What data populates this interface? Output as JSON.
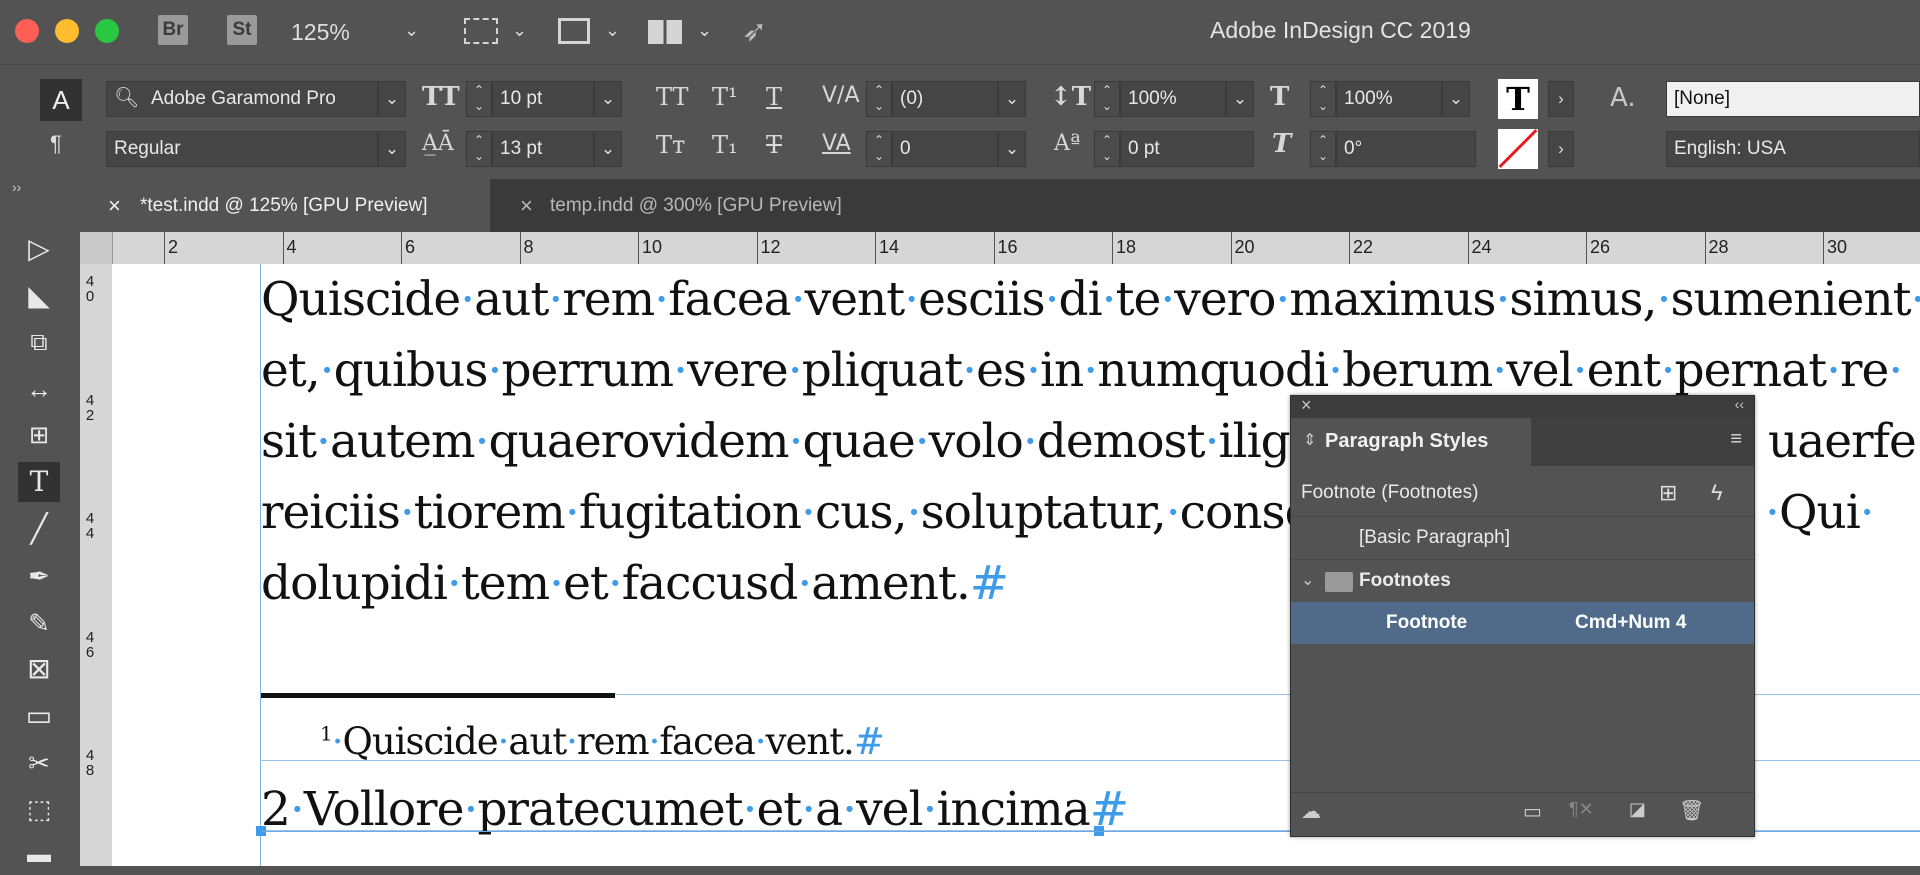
{
  "app": {
    "title": "Adobe InDesign CC 2019",
    "zoom": "125%",
    "bridge_label": "Br",
    "stock_label": "St"
  },
  "control_panel": {
    "font_family": "Adobe Garamond Pro",
    "font_style": "Regular",
    "font_size": "10 pt",
    "leading": "13 pt",
    "kerning": "(0)",
    "tracking": "0",
    "vertical_scale": "100%",
    "horizontal_scale": "100%",
    "baseline_shift": "0 pt",
    "skew": "0°",
    "char_style": "[None]",
    "language": "English: USA"
  },
  "tabs": [
    {
      "label": "*test.indd @ 125% [GPU Preview]",
      "active": true
    },
    {
      "label": "temp.indd @ 300% [GPU Preview]",
      "active": false
    }
  ],
  "ruler": {
    "h_ticks": [
      "2",
      "4",
      "6",
      "8",
      "10",
      "12",
      "14",
      "16",
      "18",
      "20",
      "22",
      "24",
      "26",
      "28",
      "30"
    ],
    "v_ticks": [
      "40",
      "42",
      "44",
      "46",
      "48"
    ]
  },
  "document": {
    "body_lines": [
      "Quiscide·aut·rem·facea·vent·esciis·di·te·vero·maximus·simus,·sumenient·",
      "et,·quibus·perrum·vere·pliquat·es·in·numquodi·berum·vel·ent·pernat·re·",
      "sit·autem·quaerovidem·quae·volo·demost·ilign",
      "reiciis·tiorem·fugitation·cus,·soluptatur,·conse",
      "dolupidi·tem·et·faccusd·ament."
    ],
    "line3_tail": "uaerfe·",
    "line4_tail": "·Qui·",
    "pilcrow_mark": "#",
    "footnote1_num": "1",
    "footnote1_text": "·Quiscide·aut·rem·facea·vent.",
    "footnote2_num": "2",
    "footnote2_text": "·Vollore·pratecumet·et·a·vel·incima"
  },
  "paragraph_styles_panel": {
    "title": "Paragraph Styles",
    "current_style": "Footnote (Footnotes)",
    "items": [
      {
        "label": "[Basic Paragraph]",
        "shortcut": ""
      },
      {
        "label": "Footnotes",
        "shortcut": "",
        "type": "group"
      },
      {
        "label": "Footnote",
        "shortcut": "Cmd+Num 4",
        "selected": true
      }
    ],
    "selected_color": "#4f6b89"
  },
  "colors": {
    "hidden_chars": "#3d9be9",
    "guides": "#7fb2e6",
    "ui_bg": "#535353"
  }
}
